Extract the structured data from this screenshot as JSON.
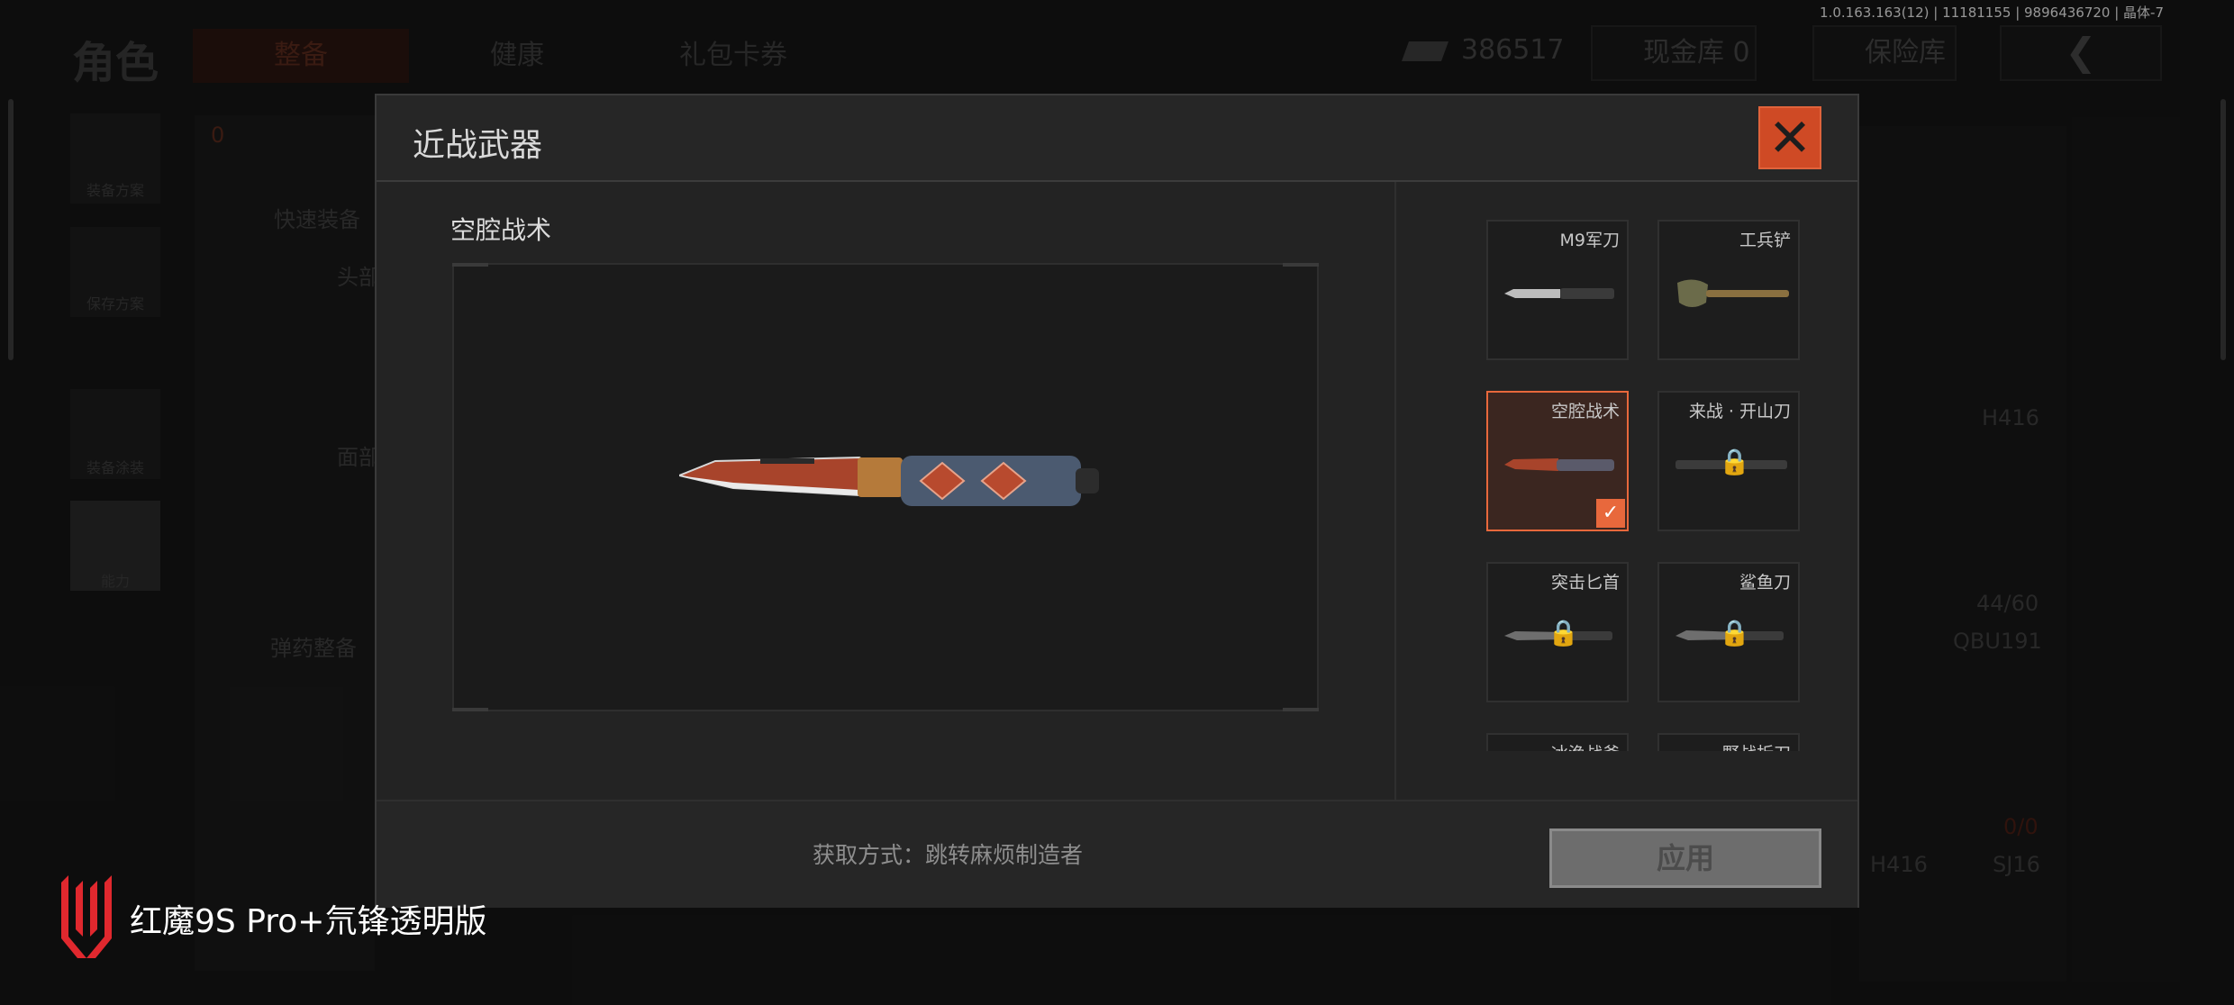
{
  "version_info": "1.0.163.163(12) | 11181155 | 9896436720 | 晶体-7",
  "background": {
    "title": "角色",
    "tabs": [
      "整备",
      "健康",
      "礼包卡券"
    ],
    "currency": "386517",
    "cash_vault": "现金库 0",
    "safe_box": "保险库",
    "side_buttons": [
      "装备方案",
      "保存方案",
      "装备涂装",
      "能力"
    ],
    "quick_equip": "快速装备",
    "ammo_equip": "弹药整备",
    "labels": [
      "头部",
      "面部",
      "H416",
      "44/60",
      "QBU191",
      "0/0",
      "H416",
      "SJ16"
    ],
    "armor_count": "0"
  },
  "modal": {
    "title": "近战武器",
    "selected_name": "空腔战术",
    "source_text": "获取方式：跳转麻烦制造者",
    "apply_label": "应用",
    "close_icon": "close-icon"
  },
  "weapons": [
    {
      "name": "M9军刀",
      "locked": false,
      "selected": false
    },
    {
      "name": "工兵铲",
      "locked": false,
      "selected": false
    },
    {
      "name": "空腔战术",
      "locked": false,
      "selected": true
    },
    {
      "name": "来战 · 开山刀",
      "locked": true,
      "selected": false
    },
    {
      "name": "突击匕首",
      "locked": true,
      "selected": false
    },
    {
      "name": "鲨鱼刀",
      "locked": true,
      "selected": false
    },
    {
      "name": "冰渔战斧",
      "locked": false,
      "selected": false
    },
    {
      "name": "野战折刀",
      "locked": false,
      "selected": false
    }
  ],
  "brand": {
    "text": "红魔9S Pro+氘锋透明版"
  },
  "colors": {
    "accent": "#e8683c",
    "close": "#cf4a25"
  }
}
